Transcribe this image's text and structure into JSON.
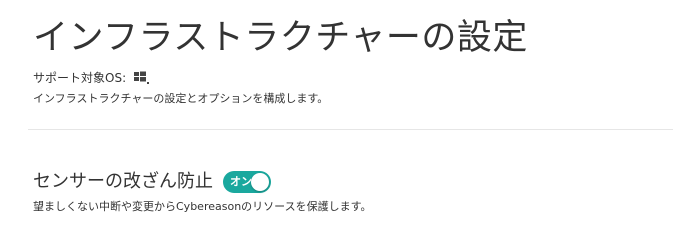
{
  "header": {
    "title": "インフラストラクチャーの設定",
    "supported_label": "サポート対象OS:",
    "supported_os": [
      "windows-icon"
    ],
    "description": "インフラストラクチャーの設定とオプションを構成します。"
  },
  "settings": [
    {
      "label": "センサーの改ざん防止",
      "toggle_text": "オン",
      "enabled": true,
      "description": "望ましくない中断や変更からCybereasonのリソースを保護します。"
    }
  ],
  "colors": {
    "toggle_on": "#1aa89e",
    "divider": "#e6e6e6",
    "text": "#333333"
  }
}
